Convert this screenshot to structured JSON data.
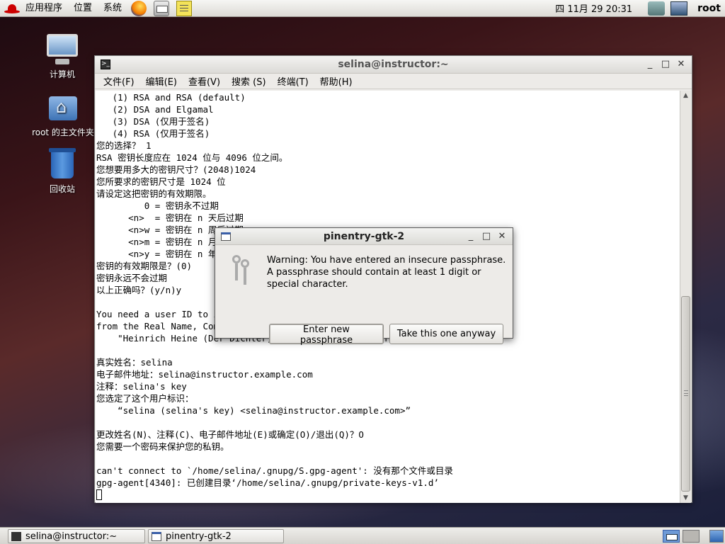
{
  "top_panel": {
    "menus": [
      "应用程序",
      "位置",
      "系统"
    ],
    "launchers": [
      "firefox-icon",
      "mail-icon",
      "notes-icon"
    ],
    "clock": "四 11月 29 20:31",
    "user": "root"
  },
  "desktop": {
    "icons": [
      {
        "label": "计算机",
        "icon": "computer-icon"
      },
      {
        "label": "root 的主文件夹",
        "icon": "home-folder-icon"
      },
      {
        "label": "回收站",
        "icon": "trash-icon"
      }
    ]
  },
  "terminal": {
    "title": "selina@instructor:~",
    "menu": [
      "文件(F)",
      "编辑(E)",
      "查看(V)",
      "搜索 (S)",
      "终端(T)",
      "帮助(H)"
    ],
    "lines": [
      "   (1) RSA and RSA (default)",
      "   (2) DSA and Elgamal",
      "   (3) DSA (仅用于签名)",
      "   (4) RSA (仅用于签名)",
      "您的选择？ 1",
      "RSA 密钥长度应在 1024 位与 4096 位之间。",
      "您想要用多大的密钥尺寸？(2048)1024",
      "您所要求的密钥尺寸是 1024 位",
      "请设定这把密钥的有效期限。",
      "         0 = 密钥永不过期",
      "      <n>  = 密钥在 n 天后过期",
      "      <n>w = 密钥在 n 周后过期",
      "      <n>m = 密钥在 n 月后过期",
      "      <n>y = 密钥在 n 年后过期",
      "密钥的有效期限是？(0)",
      "密钥永远不会过期",
      "以上正确吗？(y/n)y",
      "",
      "You need a user ID to identify your key; the software constructs the user ID",
      "from the Real Name, Comment and Email Address in this form:",
      "    \"Heinrich Heine (Der Dichter) <heinrichh@duesseldorf.de>\"",
      "",
      "真实姓名：selina",
      "电子邮件地址：selina@instructor.example.com",
      "注释：selina's key",
      "您选定了这个用户标识：",
      "    “selina (selina's key) <selina@instructor.example.com>”",
      "",
      "更改姓名(N)、注释(C)、电子邮件地址(E)或确定(O)/退出(Q)？O",
      "您需要一个密码来保护您的私钥。",
      "",
      "can't connect to `/home/selina/.gnupg/S.gpg-agent': 没有那个文件或目录",
      "gpg-agent[4340]: 已创建目录‘/home/selina/.gnupg/private-keys-v1.d’"
    ]
  },
  "dialog": {
    "title": "pinentry-gtk-2",
    "message": "Warning: You have entered an insecure passphrase. A passphrase should contain at least 1 digit or special character.",
    "btn_enter": "Enter new passphrase",
    "btn_take": "Take this one anyway"
  },
  "taskbar": {
    "tasks": [
      "selina@instructor:~",
      "pinentry-gtk-2"
    ]
  }
}
